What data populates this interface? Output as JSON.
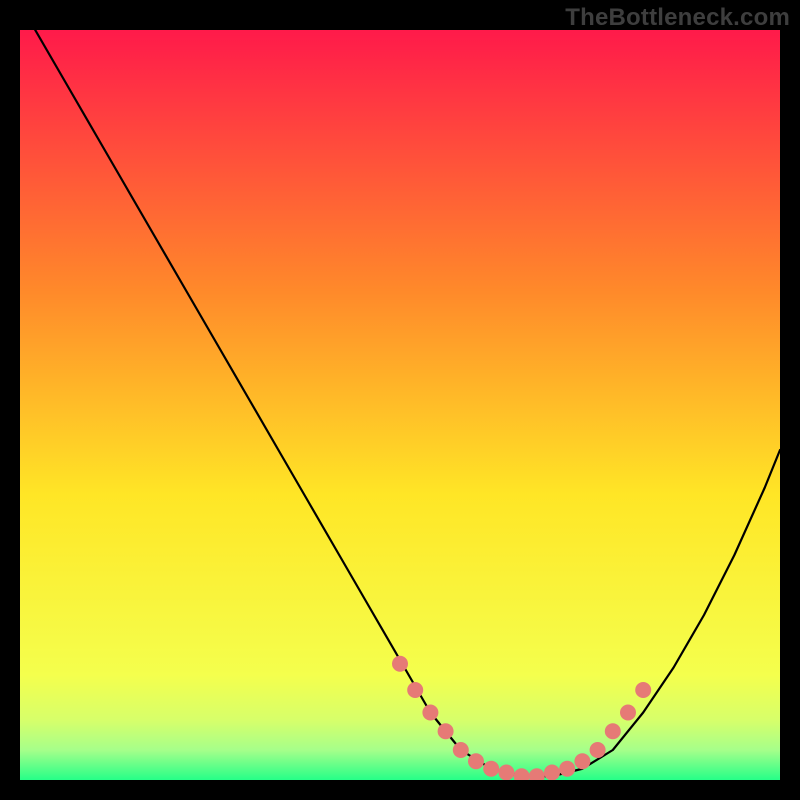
{
  "watermark": "TheBottleneck.com",
  "colors": {
    "background": "#000000",
    "watermark_text": "#3e3e3e",
    "curve": "#000000",
    "marker_fill": "#e67a76",
    "marker_stroke": "#d95b57",
    "gradient_top": "#ff1a4a",
    "gradient_mid_upper": "#ff8a2a",
    "gradient_mid": "#ffe626",
    "gradient_low1": "#f4ff4d",
    "gradient_low2": "#d7ff6a",
    "gradient_low3": "#a6ff8a",
    "gradient_bottom": "#26ff88"
  },
  "chart_data": {
    "type": "line",
    "title": "",
    "xlabel": "",
    "ylabel": "",
    "xlim": [
      0,
      100
    ],
    "ylim": [
      0,
      100
    ],
    "grid": false,
    "legend": false,
    "series": [
      {
        "name": "curve",
        "x": [
          2,
          6,
          10,
          14,
          18,
          22,
          26,
          30,
          34,
          38,
          42,
          46,
          50,
          54,
          58,
          62,
          66,
          70,
          74,
          78,
          82,
          86,
          90,
          94,
          98,
          100
        ],
        "y": [
          100,
          93,
          86,
          79,
          72,
          65,
          58,
          51,
          44,
          37,
          30,
          23,
          16,
          9,
          4,
          1.5,
          0.5,
          0.5,
          1.5,
          4,
          9,
          15,
          22,
          30,
          39,
          44
        ]
      }
    ],
    "markers": {
      "name": "optimal-band",
      "x": [
        50,
        52,
        54,
        56,
        58,
        60,
        62,
        64,
        66,
        68,
        70,
        72,
        74,
        76,
        78,
        80,
        82
      ],
      "y": [
        15.5,
        12,
        9,
        6.5,
        4,
        2.5,
        1.5,
        1,
        0.5,
        0.5,
        1,
        1.5,
        2.5,
        4,
        6.5,
        9,
        12
      ]
    }
  }
}
